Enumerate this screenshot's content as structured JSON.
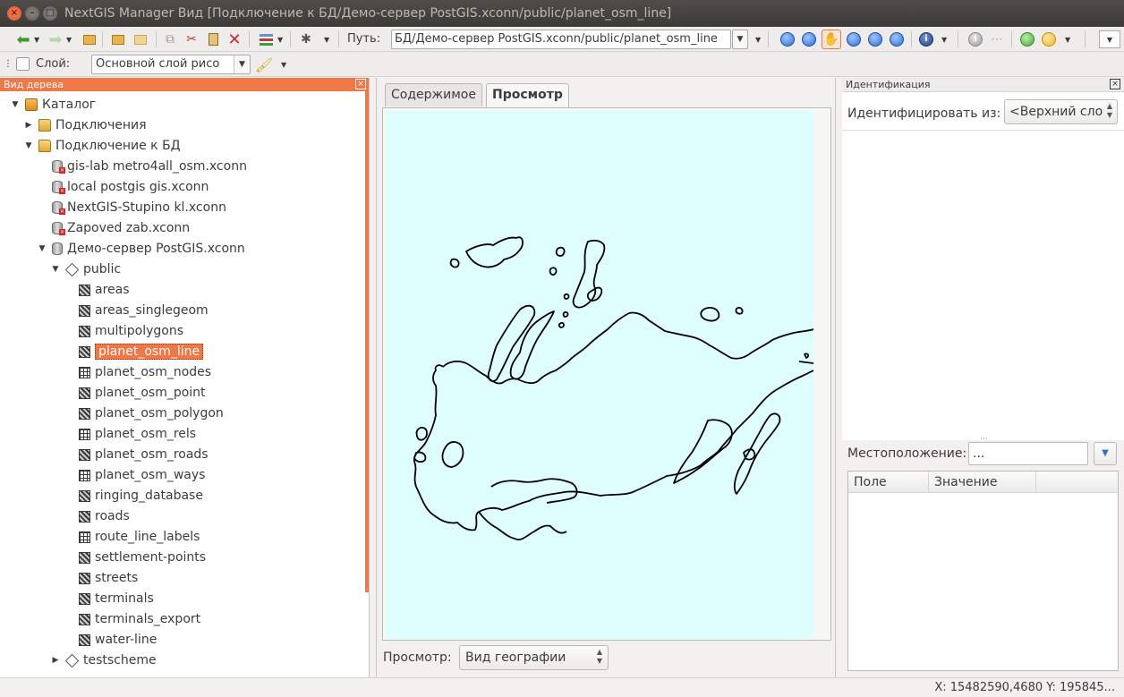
{
  "window": {
    "title": "NextGIS Manager Вид [Подключение к БД/Демо-сервер PostGIS.xconn/public/planet_osm_line]"
  },
  "toolbar": {
    "path_label": "Путь:",
    "path_value": "БД/Демо-сервер PostGIS.xconn/public/planet_osm_line",
    "layer_label": "Слой:",
    "layer_value": "Основной слой рисо"
  },
  "tree_panel": {
    "title": "Вид дерева",
    "items": [
      {
        "label": "Каталог",
        "level": 0,
        "expander": "open",
        "icon": "catalog-icon"
      },
      {
        "label": "Подключения",
        "level": 1,
        "expander": "closed",
        "icon": "folder-icon"
      },
      {
        "label": "Подключение к БД",
        "level": 1,
        "expander": "open",
        "icon": "folder-icon"
      },
      {
        "label": "gis-lab metro4all_osm.xconn",
        "level": 2,
        "expander": "none",
        "icon": "db-error-icon"
      },
      {
        "label": "local postgis  gis.xconn",
        "level": 2,
        "expander": "none",
        "icon": "db-error-icon"
      },
      {
        "label": "NextGIS-Stupino kl.xconn",
        "level": 2,
        "expander": "none",
        "icon": "db-error-icon"
      },
      {
        "label": "Zapoved zab.xconn",
        "level": 2,
        "expander": "none",
        "icon": "db-error-icon"
      },
      {
        "label": "Демо-сервер PostGIS.xconn",
        "level": 2,
        "expander": "open",
        "icon": "db-icon"
      },
      {
        "label": "public",
        "level": 3,
        "expander": "open",
        "icon": "schema-icon"
      },
      {
        "label": "areas",
        "level": 4,
        "expander": "none",
        "icon": "feature-class-icon"
      },
      {
        "label": "areas_singlegeom",
        "level": 4,
        "expander": "none",
        "icon": "feature-class-icon"
      },
      {
        "label": "multipolygons",
        "level": 4,
        "expander": "none",
        "icon": "feature-class-icon"
      },
      {
        "label": "planet_osm_line",
        "level": 4,
        "expander": "none",
        "icon": "feature-class-icon",
        "selected": true
      },
      {
        "label": "planet_osm_nodes",
        "level": 4,
        "expander": "none",
        "icon": "table-icon"
      },
      {
        "label": "planet_osm_point",
        "level": 4,
        "expander": "none",
        "icon": "feature-class-icon"
      },
      {
        "label": "planet_osm_polygon",
        "level": 4,
        "expander": "none",
        "icon": "feature-class-icon"
      },
      {
        "label": "planet_osm_rels",
        "level": 4,
        "expander": "none",
        "icon": "table-icon"
      },
      {
        "label": "planet_osm_roads",
        "level": 4,
        "expander": "none",
        "icon": "feature-class-icon"
      },
      {
        "label": "planet_osm_ways",
        "level": 4,
        "expander": "none",
        "icon": "table-icon"
      },
      {
        "label": "ringing_database",
        "level": 4,
        "expander": "none",
        "icon": "feature-class-icon"
      },
      {
        "label": "roads",
        "level": 4,
        "expander": "none",
        "icon": "feature-class-icon"
      },
      {
        "label": "route_line_labels",
        "level": 4,
        "expander": "none",
        "icon": "table-icon"
      },
      {
        "label": "settlement-points",
        "level": 4,
        "expander": "none",
        "icon": "feature-class-icon"
      },
      {
        "label": "streets",
        "level": 4,
        "expander": "none",
        "icon": "feature-class-icon"
      },
      {
        "label": "terminals",
        "level": 4,
        "expander": "none",
        "icon": "feature-class-icon"
      },
      {
        "label": "terminals_export",
        "level": 4,
        "expander": "none",
        "icon": "feature-class-icon"
      },
      {
        "label": "water-line",
        "level": 4,
        "expander": "none",
        "icon": "feature-class-icon"
      },
      {
        "label": "testscheme",
        "level": 3,
        "expander": "closed",
        "icon": "schema-icon"
      }
    ]
  },
  "center": {
    "tabs": [
      {
        "label": "Содержимое",
        "active": false
      },
      {
        "label": "Просмотр",
        "active": true
      }
    ],
    "view_label": "Просмотр:",
    "view_value": "Вид географии",
    "map_background": "#dfffff"
  },
  "identify_panel": {
    "title": "Идентификация",
    "identify_from_label": "Идентифицировать из:",
    "identify_from_value": "<Верхний сло",
    "location_label": "Местоположение:",
    "location_value": "...",
    "columns": [
      "Поле",
      "Значение"
    ]
  },
  "status": {
    "coordinates": "X: 15482590,4680 Y: 195845..."
  },
  "colors": {
    "accent": "#f07746",
    "titlebar": "#3c3b37"
  }
}
